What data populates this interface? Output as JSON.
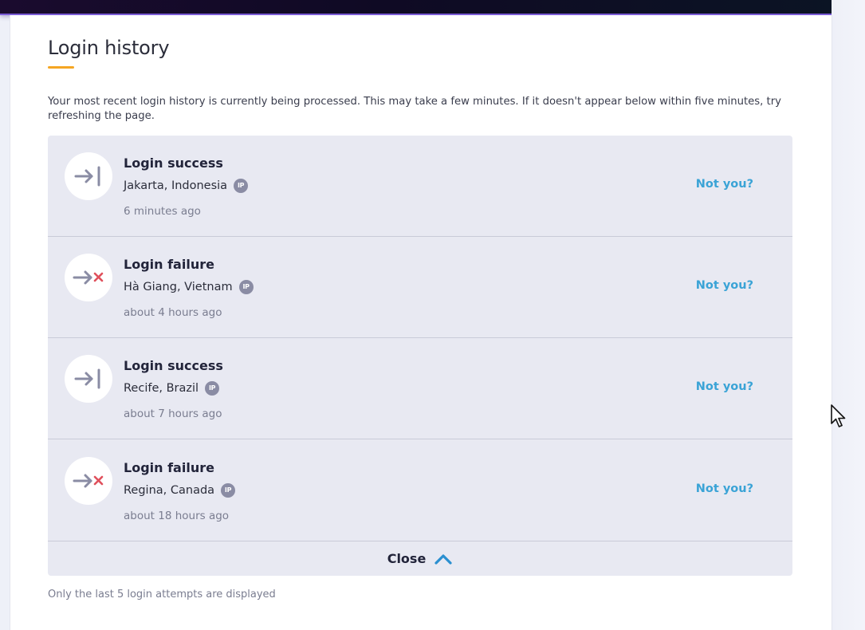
{
  "section": {
    "title": "Login history",
    "intro": "Your most recent login history is currently being processed. This may take a few minutes. If it doesn't appear below within five minutes, try refreshing the page.",
    "footnote": "Only the last 5 login attempts are displayed",
    "accent_color": "#f5a623",
    "link_color": "#3aa3d6",
    "failure_color": "#e0505c"
  },
  "history": {
    "items": [
      {
        "status": "Login success",
        "location": "Jakarta, Indonesia",
        "ip_badge": "IP",
        "time": "6 minutes ago",
        "action": "Not you?",
        "icon": "login-success-icon"
      },
      {
        "status": "Login failure",
        "location": "Hà Giang, Vietnam",
        "ip_badge": "IP",
        "time": "about 4 hours ago",
        "action": "Not you?",
        "icon": "login-failure-icon"
      },
      {
        "status": "Login success",
        "location": "Recife, Brazil",
        "ip_badge": "IP",
        "time": "about 7 hours ago",
        "action": "Not you?",
        "icon": "login-success-icon"
      },
      {
        "status": "Login failure",
        "location": "Regina, Canada",
        "ip_badge": "IP",
        "time": "about 18 hours ago",
        "action": "Not you?",
        "icon": "login-failure-icon"
      }
    ],
    "close_label": "Close",
    "close_icon": "chevron-up-icon"
  }
}
